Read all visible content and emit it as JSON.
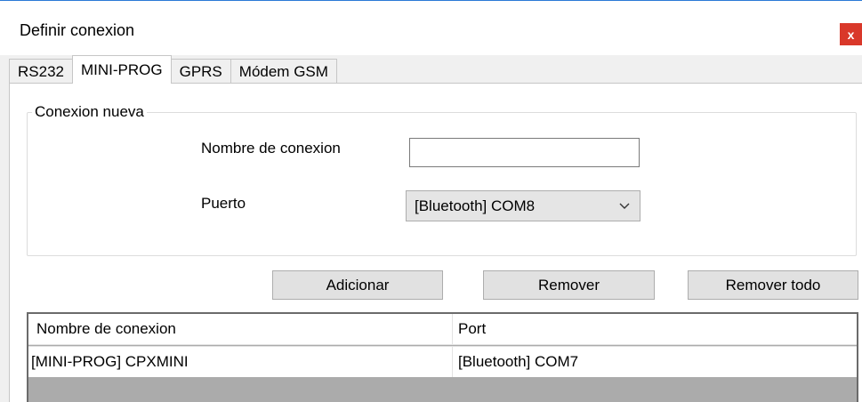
{
  "window": {
    "title": "Definir conexion",
    "close_label": "x"
  },
  "tabs": [
    {
      "label": "RS232",
      "active": false
    },
    {
      "label": "MINI-PROG",
      "active": true
    },
    {
      "label": "GPRS",
      "active": false
    },
    {
      "label": "Módem GSM",
      "active": false
    }
  ],
  "new_connection": {
    "group_title": "Conexion nueva",
    "name_label": "Nombre de conexion",
    "name_value": "",
    "port_label": "Puerto",
    "port_selected": "[Bluetooth] COM8"
  },
  "buttons": {
    "add": "Adicionar",
    "remove": "Remover",
    "remove_all": "Remover todo"
  },
  "table": {
    "columns": [
      "Nombre de conexion",
      "Port"
    ],
    "rows": [
      [
        "[MINI-PROG] CPXMINI",
        "[Bluetooth] COM7"
      ]
    ]
  },
  "colors": {
    "accent_line": "#2b79d6",
    "close_button": "#d9382a"
  }
}
